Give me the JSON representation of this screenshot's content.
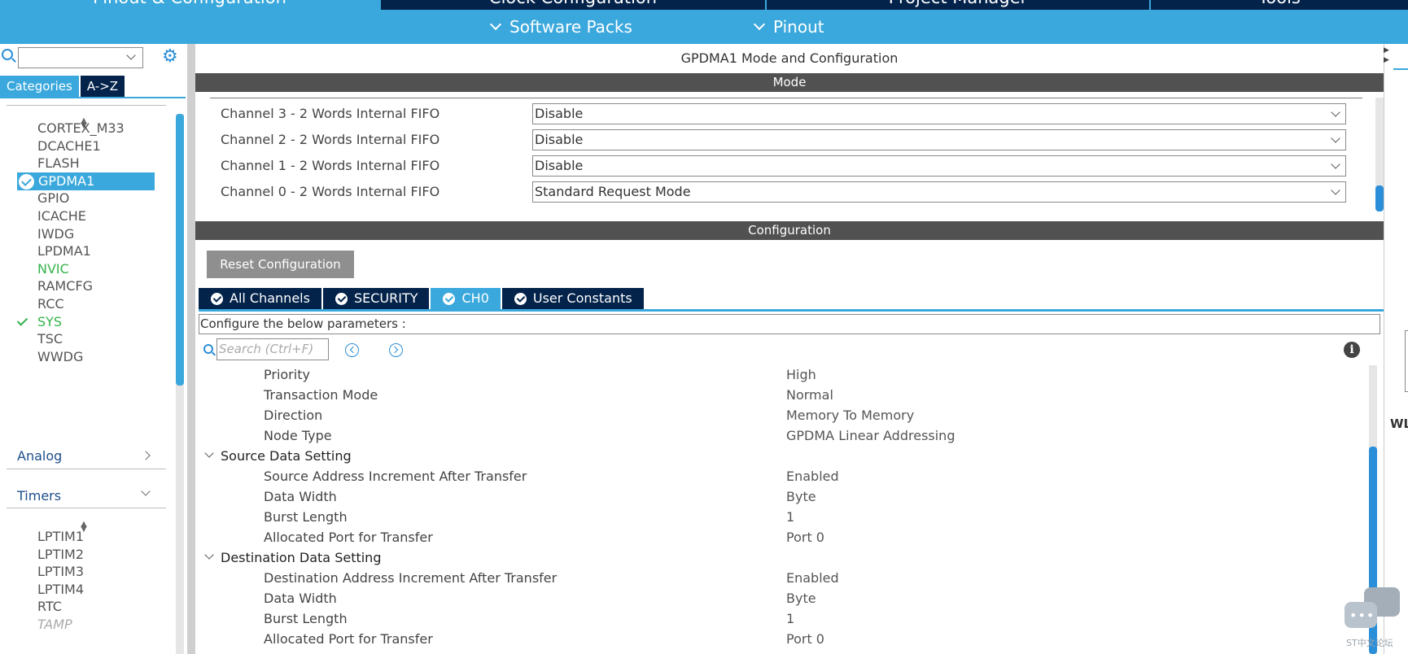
{
  "top_tabs": [
    "Pinout & Configuration",
    "Clock Configuration",
    "Project Manager",
    "Tools"
  ],
  "sub_menu": [
    "Software Packs",
    "Pinout"
  ],
  "left_panel": {
    "category_tabs": [
      "Categories",
      "A->Z"
    ],
    "system_core_items": [
      {
        "label": "CORTEX_M33",
        "state": "normal"
      },
      {
        "label": "DCACHE1",
        "state": "normal"
      },
      {
        "label": "FLASH",
        "state": "normal"
      },
      {
        "label": "GPDMA1",
        "state": "selected"
      },
      {
        "label": "GPIO",
        "state": "normal"
      },
      {
        "label": "ICACHE",
        "state": "normal"
      },
      {
        "label": "IWDG",
        "state": "normal"
      },
      {
        "label": "LPDMA1",
        "state": "normal"
      },
      {
        "label": "NVIC",
        "state": "green"
      },
      {
        "label": "RAMCFG",
        "state": "normal"
      },
      {
        "label": "RCC",
        "state": "normal"
      },
      {
        "label": "SYS",
        "state": "checked"
      },
      {
        "label": "TSC",
        "state": "normal"
      },
      {
        "label": "WWDG",
        "state": "normal"
      }
    ],
    "groups": [
      "Analog",
      "Timers"
    ],
    "timer_items": [
      {
        "label": "LPTIM1",
        "state": "normal"
      },
      {
        "label": "LPTIM2",
        "state": "normal"
      },
      {
        "label": "LPTIM3",
        "state": "normal"
      },
      {
        "label": "LPTIM4",
        "state": "normal"
      },
      {
        "label": "RTC",
        "state": "normal"
      },
      {
        "label": "TAMP",
        "state": "disabled"
      }
    ]
  },
  "main": {
    "title": "GPDMA1 Mode and Configuration",
    "mode_header": "Mode",
    "channels": [
      {
        "label": "Channel 3  - 2 Words Internal FIFO",
        "value": "Disable"
      },
      {
        "label": "Channel 2  - 2 Words Internal FIFO",
        "value": "Disable"
      },
      {
        "label": "Channel 1  - 2 Words Internal FIFO",
        "value": "Disable"
      },
      {
        "label": "Channel 0  - 2 Words Internal FIFO",
        "value": "Standard Request Mode"
      }
    ],
    "config_header": "Configuration",
    "reset_label": "Reset Configuration",
    "config_tabs": [
      "All Channels",
      "SECURITY",
      "CH0",
      "User Constants"
    ],
    "description": "Configure the below parameters :",
    "search_placeholder": "Search (Ctrl+F)",
    "params": [
      {
        "type": "param",
        "name": "Priority",
        "value": "High"
      },
      {
        "type": "param",
        "name": "Transaction Mode",
        "value": "Normal"
      },
      {
        "type": "param",
        "name": "Direction",
        "value": "Memory To Memory"
      },
      {
        "type": "param",
        "name": "Node Type",
        "value": "GPDMA Linear Addressing"
      },
      {
        "type": "group",
        "name": "Source Data Setting"
      },
      {
        "type": "param",
        "name": "Source Address Increment After Transfer",
        "value": "Enabled"
      },
      {
        "type": "param",
        "name": "Data Width",
        "value": "Byte"
      },
      {
        "type": "param",
        "name": "Burst Length",
        "value": "1"
      },
      {
        "type": "param",
        "name": "Allocated Port for Transfer",
        "value": "Port 0"
      },
      {
        "type": "group",
        "name": "Destination Data Setting"
      },
      {
        "type": "param",
        "name": "Destination Address Increment After Transfer",
        "value": "Enabled"
      },
      {
        "type": "param",
        "name": "Data Width",
        "value": "Byte"
      },
      {
        "type": "param",
        "name": "Burst Length",
        "value": "1"
      },
      {
        "type": "param",
        "name": "Allocated Port for Transfer",
        "value": "Port 0"
      }
    ]
  },
  "right_strip_text": "WL",
  "watermark_text": "ST中文论坛",
  "colors": {
    "accent": "#3aa8dc",
    "dark_navy": "#03234b",
    "section_gray": "#515151",
    "green": "#34b34a"
  }
}
